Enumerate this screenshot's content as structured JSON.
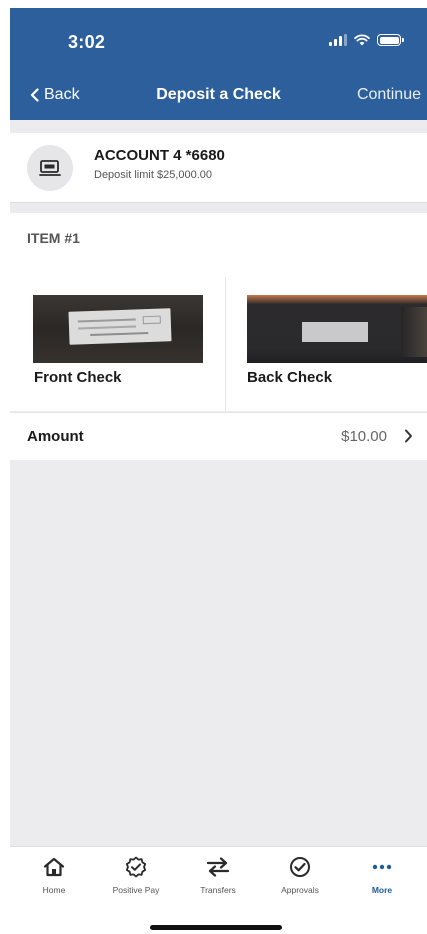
{
  "status_bar": {
    "time": "3:02"
  },
  "nav": {
    "back_label": "Back",
    "title": "Deposit a Check",
    "continue_label": "Continue"
  },
  "account": {
    "name": "ACCOUNT 4 *6680",
    "limit": "Deposit limit $25,000.00",
    "icon": "check-deposit-icon"
  },
  "item": {
    "label": "ITEM #1",
    "front_label": "Front Check",
    "back_label": "Back Check"
  },
  "amount": {
    "label": "Amount",
    "value": "$10.00"
  },
  "tabs": [
    {
      "label": "Home",
      "icon": "home-icon",
      "active": false
    },
    {
      "label": "Positive Pay",
      "icon": "badge-check-icon",
      "active": false
    },
    {
      "label": "Transfers",
      "icon": "transfer-arrows-icon",
      "active": false
    },
    {
      "label": "Approvals",
      "icon": "check-circle-icon",
      "active": false
    },
    {
      "label": "More",
      "icon": "more-dots-icon",
      "active": true
    }
  ],
  "colors": {
    "header": "#2c5f9b",
    "accent": "#1f5c99",
    "background": "#ececee"
  }
}
